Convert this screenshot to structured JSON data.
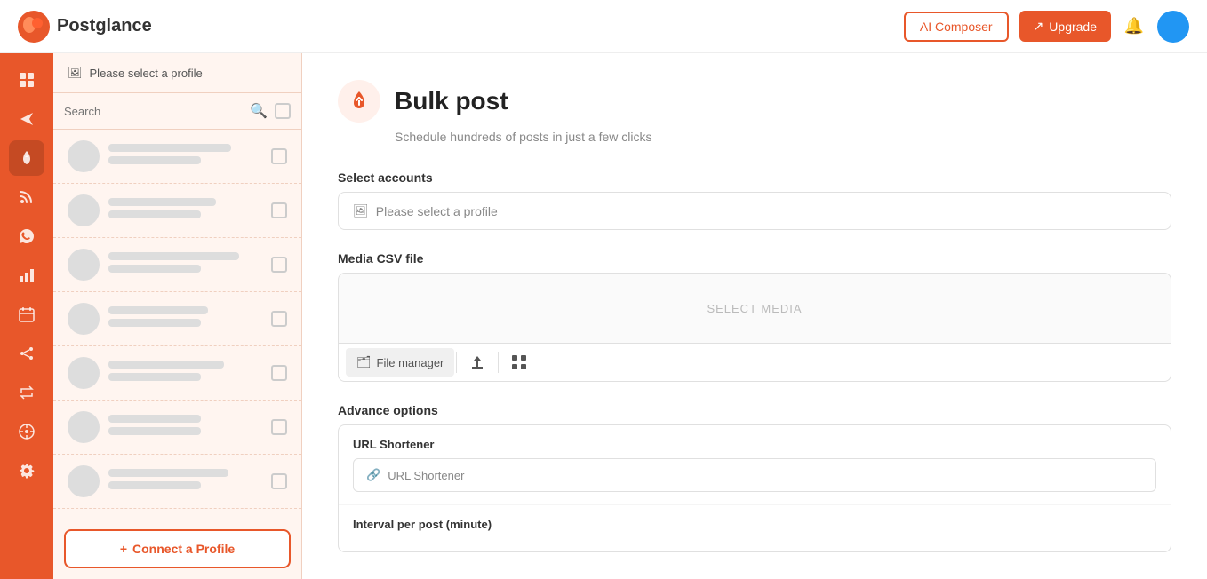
{
  "header": {
    "logo_text": "Postglance",
    "ai_composer_label": "AI Composer",
    "upgrade_label": "Upgrade",
    "upgrade_icon": "↗"
  },
  "sidebar": {
    "icons": [
      {
        "name": "dashboard-icon",
        "symbol": "⊡",
        "title": "Dashboard"
      },
      {
        "name": "send-icon",
        "symbol": "✈",
        "title": "Send"
      },
      {
        "name": "rocket-icon",
        "symbol": "🚀",
        "title": "Bulk Post"
      },
      {
        "name": "rss-icon",
        "symbol": "📡",
        "title": "RSS"
      },
      {
        "name": "whatsapp-icon",
        "symbol": "💬",
        "title": "WhatsApp"
      },
      {
        "name": "chart-icon",
        "symbol": "📊",
        "title": "Analytics"
      },
      {
        "name": "calendar-icon",
        "symbol": "📅",
        "title": "Calendar"
      },
      {
        "name": "share-icon",
        "symbol": "⇄",
        "title": "Share"
      },
      {
        "name": "repost-icon",
        "symbol": "↺",
        "title": "Repost"
      },
      {
        "name": "discovery-icon",
        "symbol": "⊙",
        "title": "Discovery"
      },
      {
        "name": "settings-icon",
        "symbol": "⚙",
        "title": "Settings"
      }
    ]
  },
  "profile_panel": {
    "header_text": "Please select a profile",
    "search_placeholder": "Search",
    "profile_items_count": 7,
    "connect_profile_label": "Connect a Profile"
  },
  "main": {
    "page_title": "Bulk post",
    "page_subtitle": "Schedule hundreds of posts in just a few clicks",
    "select_accounts_label": "Select accounts",
    "select_accounts_placeholder": "Please select a profile",
    "media_csv_label": "Media CSV file",
    "select_media_text": "SELECT MEDIA",
    "file_manager_label": "File manager",
    "advance_options_label": "Advance options",
    "url_shortener_label": "URL Shortener",
    "url_shortener_placeholder": "URL Shortener",
    "interval_label": "Interval per post (minute)"
  }
}
